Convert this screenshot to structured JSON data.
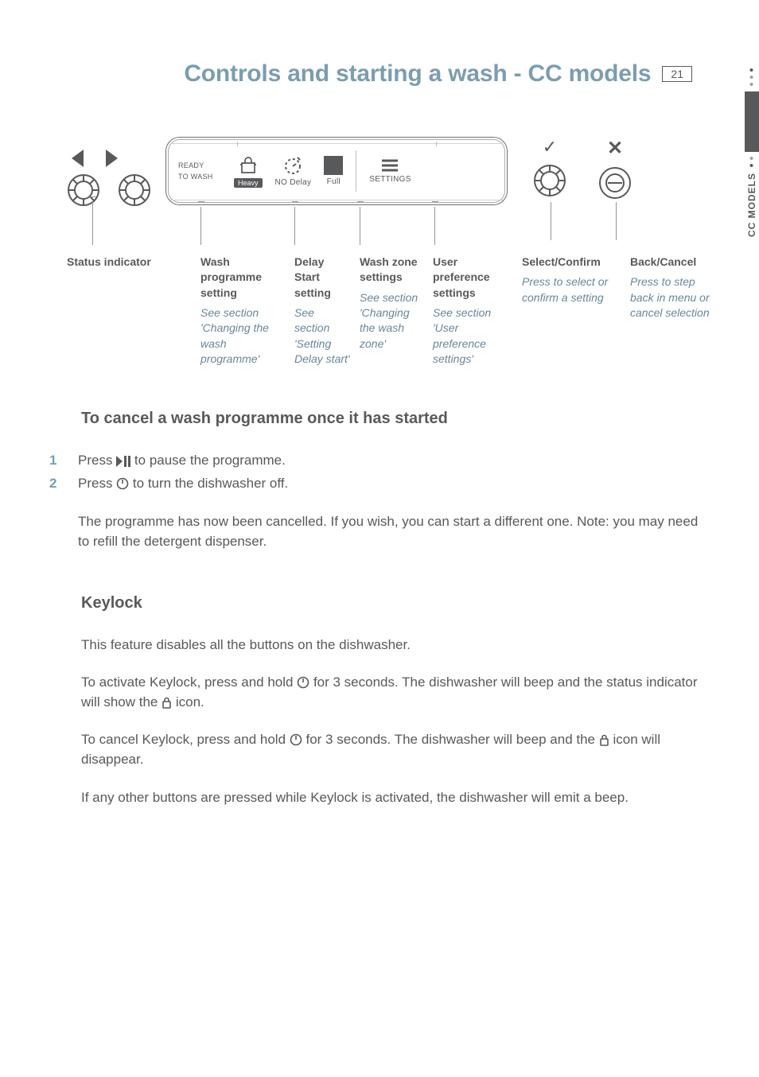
{
  "page_number": "21",
  "header_title": "Controls and starting a wash - CC models",
  "side_tab_label": "CC MODELS",
  "display": {
    "ready_line1": "READY",
    "ready_line2": "TO WASH",
    "heavy": "Heavy",
    "no_delay": "NO Delay",
    "full": "Full",
    "settings": "SETTINGS"
  },
  "callouts": [
    {
      "title": "Status indicator",
      "sub": ""
    },
    {
      "title": "Wash programme setting",
      "sub": "See section 'Changing the wash programme'"
    },
    {
      "title": "Delay Start setting",
      "sub": "See section 'Setting Delay start'"
    },
    {
      "title": "Wash zone settings",
      "sub": "See section 'Changing the wash zone'"
    },
    {
      "title": "User preference settings",
      "sub": "See section 'User preference settings'"
    },
    {
      "title": "Select/Confirm",
      "sub": "Press to select or confirm a setting"
    },
    {
      "title": "Back/Cancel",
      "sub": "Press to step back in menu or cancel selection"
    }
  ],
  "sections": {
    "cancel_title": "To cancel a wash programme once it has started",
    "cancel_step1_a": "Press ",
    "cancel_step1_b": " to pause the programme.",
    "cancel_step2_a": "Press ",
    "cancel_step2_b": "  to turn the dishwasher off.",
    "cancel_para": "The programme has now been cancelled. If you wish, you can start a different one. Note: you may need to refill the detergent dispenser.",
    "keylock_title": "Keylock",
    "keylock_p1": "This feature disables all the buttons on the dishwasher.",
    "keylock_p2_a": "To activate Keylock, press and hold ",
    "keylock_p2_b": " for 3 seconds. The dishwasher will beep and the status indicator will show the ",
    "keylock_p2_c": "  icon.",
    "keylock_p3_a": "To cancel Keylock, press and hold ",
    "keylock_p3_b": " for 3 seconds. The dishwasher will beep and the ",
    "keylock_p3_c": "  icon will disappear.",
    "keylock_p4": "If any other buttons are pressed while Keylock is activated, the dishwasher will emit a beep."
  },
  "step_labels": {
    "one": "1",
    "two": "2"
  },
  "icons": {
    "play_pause": "play-pause-icon",
    "power": "power-icon",
    "lock": "lock-icon"
  }
}
